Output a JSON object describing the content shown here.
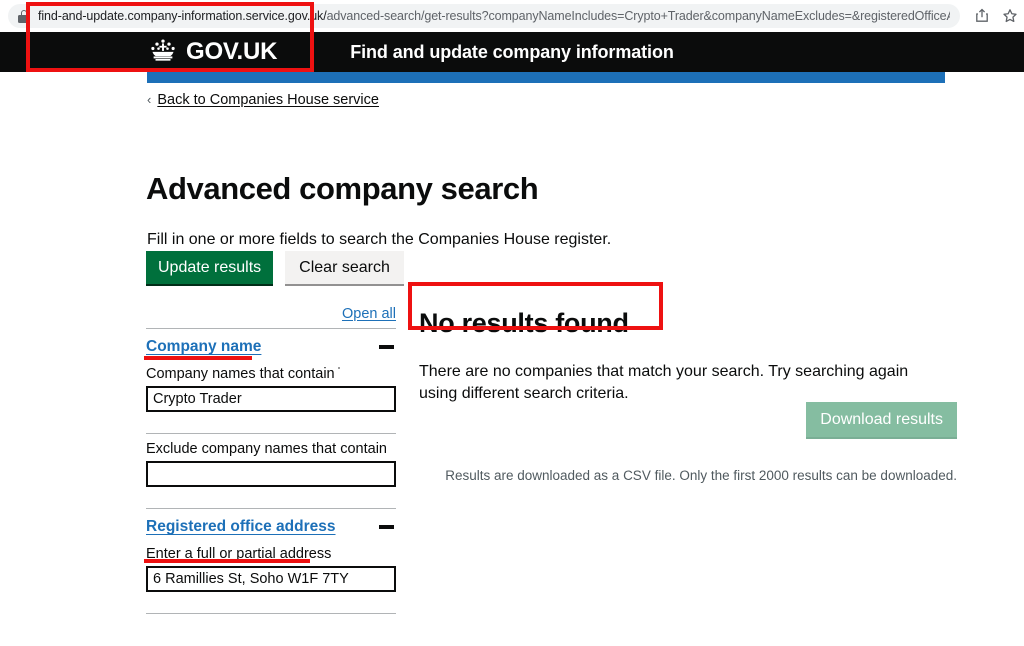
{
  "browser": {
    "url_host": "find-and-update.company-information.service.gov.uk/",
    "url_path": "advanced-search/get-results?companyNameIncludes=Crypto+Trader&companyNameExcludes=&registeredOfficeAddress=6...",
    "lock_icon": "lock-icon",
    "share_icon": "share-icon",
    "bookmark_icon": "star-icon"
  },
  "header": {
    "crown_icon": "crown-icon",
    "brand": "GOV.UK",
    "service_name": "Find and update company information"
  },
  "page": {
    "back_chevron": "‹",
    "back_link": "Back to Companies House service",
    "title": "Advanced company search",
    "intro": "Fill in one or more fields to search the Companies House register."
  },
  "buttons": {
    "update_results": "Update results",
    "clear_search": "Clear search"
  },
  "search_form": {
    "open_all": "Open all",
    "sections": [
      {
        "title": "Company name",
        "toggle_icon": "minus-icon",
        "fields": [
          {
            "label": "Company names that contain",
            "value": "Crypto Trader",
            "placeholder": ""
          },
          {
            "label": "Exclude company names that contain",
            "value": "",
            "placeholder": ""
          }
        ]
      },
      {
        "title": "Registered office address",
        "toggle_icon": "minus-icon",
        "fields": [
          {
            "label": "Enter a full or partial address",
            "value": "6 Ramillies St, Soho W1F 7TY",
            "placeholder": ""
          }
        ]
      }
    ]
  },
  "results": {
    "heading": "No results found",
    "body": "There are no companies that match your search. Try searching again using different search criteria.",
    "download_button": "Download results",
    "download_note": "Results are downloaded as a CSV file. Only the first 2000 results can be downloaded."
  },
  "colors": {
    "govuk_black": "#0b0c0c",
    "govuk_blue": "#1d70b8",
    "govuk_green": "#00703c",
    "green_disabled": "#85bda1",
    "annotation_red": "#ee1111",
    "grey_button": "#f3f2f1"
  }
}
